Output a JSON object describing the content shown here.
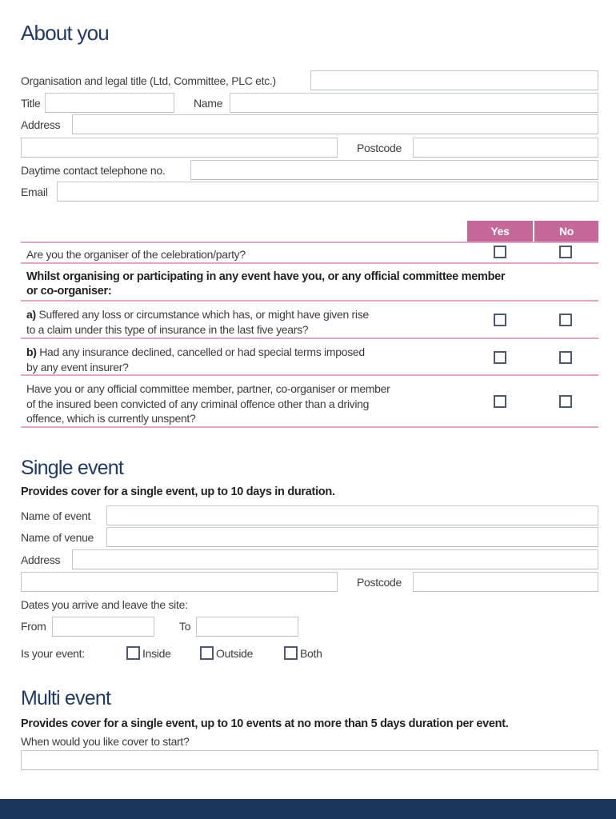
{
  "about": {
    "heading": "About you",
    "org_label": "Organisation and legal title (Ltd, Committee, PLC etc.)",
    "title_label": "Title",
    "name_label": "Name",
    "address_label": "Address",
    "postcode_label": "Postcode",
    "phone_label": "Daytime contact telephone no.",
    "email_label": "Email",
    "fields": {
      "org": "",
      "title": "",
      "name": "",
      "address1": "",
      "address2": "",
      "postcode": "",
      "phone": "",
      "email": ""
    }
  },
  "questions": {
    "yes_label": "Yes",
    "no_label": "No",
    "q_organiser": "Are you the organiser of the celebration/party?",
    "intro_line1": "Whilst organising or participating in any event have you, or any official committee member",
    "intro_line2": "or co-organiser:",
    "qa_prefix": "a)",
    "qa_line1": " Suffered any loss or circumstance which has, or might have given rise",
    "qa_line2": "to a claim under this type of insurance in the last five years?",
    "qb_prefix": "b)",
    "qb_line1": " Had any insurance declined, cancelled or had special terms imposed",
    "qb_line2": "by any event insurer?",
    "qc_line1": "Have you or any official committee member, partner, co-organiser or member",
    "qc_line2": "of the insured been convicted of any criminal offence other than a driving",
    "qc_line3": "offence, which is currently unspent?",
    "answers": {
      "organiser": {
        "yes": false,
        "no": false
      },
      "a": {
        "yes": false,
        "no": false
      },
      "b": {
        "yes": false,
        "no": false
      },
      "c": {
        "yes": false,
        "no": false
      }
    }
  },
  "single_event": {
    "heading": "Single event",
    "description": "Provides cover for a single event, up to 10 days in duration.",
    "event_name_label": "Name of event",
    "venue_label": "Name of venue",
    "address_label": "Address",
    "postcode_label": "Postcode",
    "dates_label": "Dates you arrive and leave the site:",
    "from_label": "From",
    "to_label": "To",
    "location_label": "Is your event:",
    "location_options": [
      "Inside",
      "Outside",
      "Both"
    ],
    "fields": {
      "event_name": "",
      "venue": "",
      "address1": "",
      "address2": "",
      "postcode": "",
      "from": "",
      "to": ""
    }
  },
  "multi_event": {
    "heading": "Multi event",
    "description": "Provides cover for a single event, up to 10 events at no more than 5 days duration per event.",
    "start_label": "When would you like cover to start?",
    "fields": {
      "start": ""
    }
  },
  "colors": {
    "heading": "#1f3a66",
    "accent_pink": "#c4689a",
    "divider_pink": "#e3a5c5",
    "footer_navy": "#1b365d"
  }
}
